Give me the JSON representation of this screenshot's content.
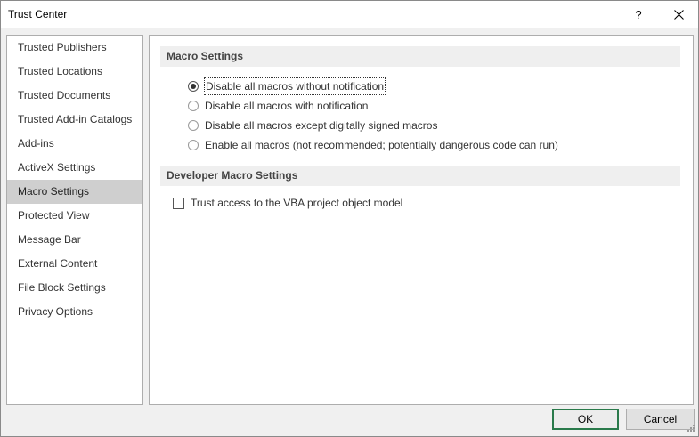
{
  "window": {
    "title": "Trust Center",
    "help_label": "?"
  },
  "sidebar": {
    "items": [
      {
        "label": "Trusted Publishers",
        "selected": false
      },
      {
        "label": "Trusted Locations",
        "selected": false
      },
      {
        "label": "Trusted Documents",
        "selected": false
      },
      {
        "label": "Trusted Add-in Catalogs",
        "selected": false
      },
      {
        "label": "Add-ins",
        "selected": false
      },
      {
        "label": "ActiveX Settings",
        "selected": false
      },
      {
        "label": "Macro Settings",
        "selected": true
      },
      {
        "label": "Protected View",
        "selected": false
      },
      {
        "label": "Message Bar",
        "selected": false
      },
      {
        "label": "External Content",
        "selected": false
      },
      {
        "label": "File Block Settings",
        "selected": false
      },
      {
        "label": "Privacy Options",
        "selected": false
      }
    ]
  },
  "macro_settings": {
    "header": "Macro Settings",
    "options": [
      {
        "label": "Disable all macros without notification",
        "checked": true
      },
      {
        "label": "Disable all macros with notification",
        "checked": false
      },
      {
        "label": "Disable all macros except digitally signed macros",
        "checked": false
      },
      {
        "label": "Enable all macros (not recommended; potentially dangerous code can run)",
        "checked": false
      }
    ]
  },
  "developer_settings": {
    "header": "Developer Macro Settings",
    "vba_access_label": "Trust access to the VBA project object model",
    "vba_access_checked": false
  },
  "footer": {
    "ok_label": "OK",
    "cancel_label": "Cancel"
  }
}
